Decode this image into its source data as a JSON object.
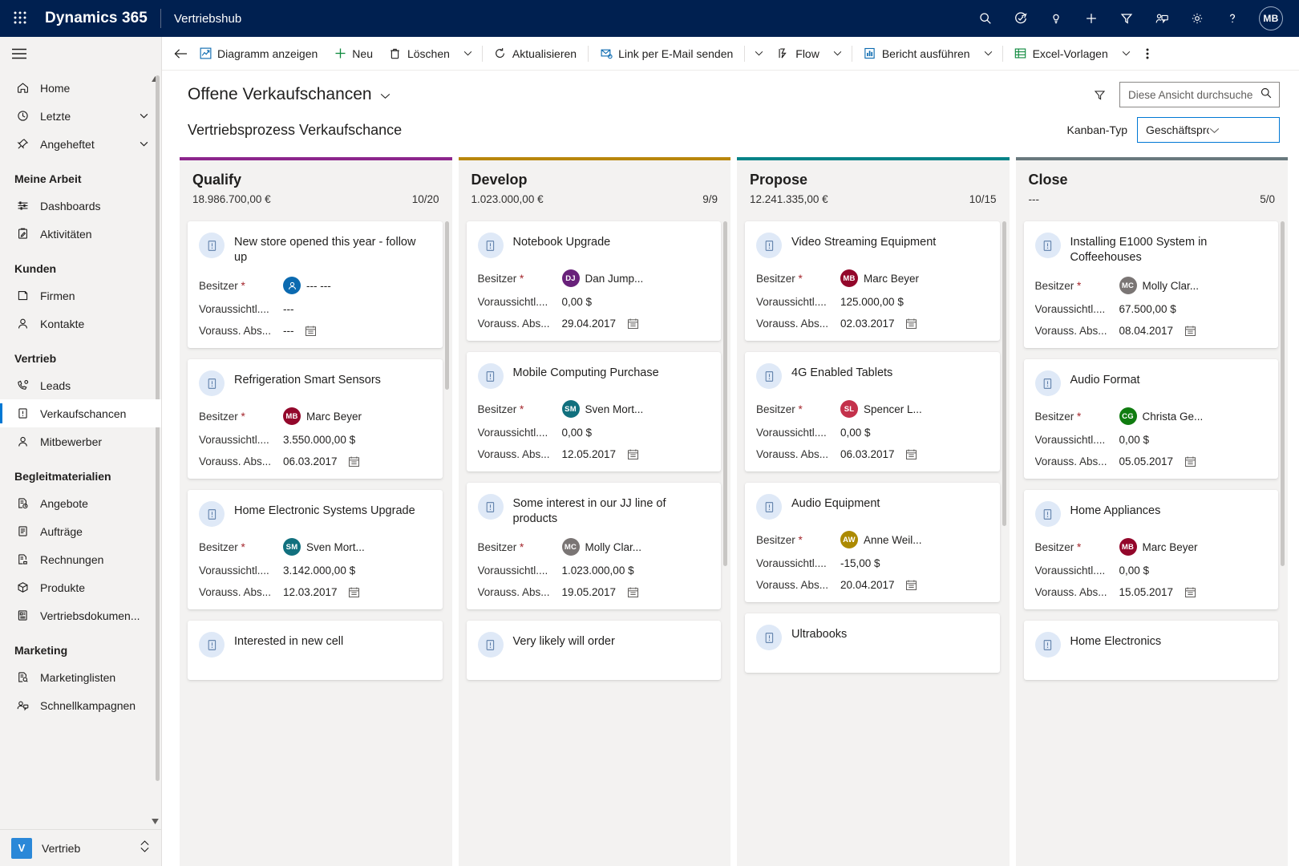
{
  "topnav": {
    "waffle_icon": "app-launcher-icon",
    "brand": "Dynamics 365",
    "app_name": "Vertriebshub",
    "icons": [
      {
        "name": "search-icon"
      },
      {
        "name": "relationship-assistant-icon"
      },
      {
        "name": "lightbulb-icon"
      },
      {
        "name": "quick-create-icon"
      },
      {
        "name": "filter-icon"
      },
      {
        "name": "assistant-card-icon"
      },
      {
        "name": "settings-gear-icon"
      },
      {
        "name": "help-question-icon"
      }
    ],
    "avatar": "MB"
  },
  "commandbar": {
    "back_icon": "back-arrow-icon",
    "items": [
      {
        "label": "Diagramm anzeigen",
        "icon": "chart-icon",
        "chevron": false
      },
      {
        "label": "Neu",
        "icon": "plus-icon",
        "chevron": false
      },
      {
        "label": "Löschen",
        "icon": "trash-icon",
        "chevron": true
      },
      {
        "label": "Aktualisieren",
        "icon": "refresh-icon",
        "chevron": false
      },
      {
        "label": "Link per E-Mail senden",
        "icon": "email-link-icon",
        "chevron": true
      },
      {
        "label": "Flow",
        "icon": "flow-icon",
        "chevron": true
      },
      {
        "label": "Bericht ausführen",
        "icon": "report-icon",
        "chevron": true
      },
      {
        "label": "Excel-Vorlagen",
        "icon": "excel-icon",
        "chevron": true
      }
    ],
    "overflow_icon": "more-vertical-icon"
  },
  "viewbar": {
    "view_title": "Offene Verkaufschancen",
    "view_chevron_icon": "chevron-down-icon",
    "filter_icon": "filter-icon",
    "search_placeholder": "Diese Ansicht durchsuche",
    "search_value": "",
    "search_icon": "search-icon"
  },
  "process": {
    "title": "Vertriebsprozess Verkaufschance",
    "kanban_label": "Kanban-Typ",
    "kanban_value": "Geschäftsprozessfluss",
    "kanban_chevron_icon": "chevron-down-icon"
  },
  "sidebar": {
    "hamburger_icon": "hamburger-icon",
    "top_items": [
      {
        "label": "Home",
        "icon": "home-icon",
        "chevron": false,
        "active": false
      },
      {
        "label": "Letzte",
        "icon": "clock-icon",
        "chevron": true,
        "active": false
      },
      {
        "label": "Angeheftet",
        "icon": "pin-icon",
        "chevron": true,
        "active": false
      }
    ],
    "groups": [
      {
        "title": "Meine Arbeit",
        "items": [
          {
            "label": "Dashboards",
            "icon": "dashboard-icon",
            "active": false
          },
          {
            "label": "Aktivitäten",
            "icon": "activities-icon",
            "active": false
          }
        ]
      },
      {
        "title": "Kunden",
        "items": [
          {
            "label": "Firmen",
            "icon": "accounts-icon",
            "active": false
          },
          {
            "label": "Kontakte",
            "icon": "contacts-icon",
            "active": false
          }
        ]
      },
      {
        "title": "Vertrieb",
        "items": [
          {
            "label": "Leads",
            "icon": "leads-icon",
            "active": false
          },
          {
            "label": "Verkaufschancen",
            "icon": "opportunities-icon",
            "active": true
          },
          {
            "label": "Mitbewerber",
            "icon": "competitors-icon",
            "active": false
          }
        ]
      },
      {
        "title": "Begleitmaterialien",
        "items": [
          {
            "label": "Angebote",
            "icon": "quotes-icon",
            "active": false
          },
          {
            "label": "Aufträge",
            "icon": "orders-icon",
            "active": false
          },
          {
            "label": "Rechnungen",
            "icon": "invoices-icon",
            "active": false
          },
          {
            "label": "Produkte",
            "icon": "products-icon",
            "active": false
          },
          {
            "label": "Vertriebsdokumen...",
            "icon": "sales-literature-icon",
            "active": false
          }
        ]
      },
      {
        "title": "Marketing",
        "items": [
          {
            "label": "Marketinglisten",
            "icon": "marketing-lists-icon",
            "active": false
          },
          {
            "label": "Schnellkampagnen",
            "icon": "quick-campaigns-icon",
            "active": false
          }
        ]
      }
    ],
    "app_switcher": {
      "initial": "V",
      "label": "Vertrieb",
      "chevron_icon": "updown-chevron-icon"
    }
  },
  "card_labels": {
    "owner": "Besitzer",
    "required_mark": "*",
    "est_revenue": "Voraussichtl....",
    "est_close": "Vorauss. Abs...",
    "calendar_icon": "calendar-icon",
    "record-icon": "opportunity-record-icon"
  },
  "board": {
    "columns": [
      {
        "name": "Qualify",
        "accent": "#8c258c",
        "sum": "18.986.700,00 €",
        "count": "10/20",
        "cards": [
          {
            "title": "New store opened this year - follow up",
            "owner": "--- ---",
            "owner_initials": "",
            "owner_color": "#0b6ab0",
            "revenue": "---",
            "close_date": "---"
          },
          {
            "title": "Refrigeration Smart Sensors",
            "owner": "Marc Beyer",
            "owner_initials": "MB",
            "owner_color": "#93072b",
            "revenue": "3.550.000,00 $",
            "close_date": "06.03.2017"
          },
          {
            "title": "Home Electronic Systems Upgrade",
            "owner": "Sven Mort...",
            "owner_initials": "SM",
            "owner_color": "#11707e",
            "revenue": "3.142.000,00 $",
            "close_date": "12.03.2017"
          },
          {
            "title": "Interested in new cell",
            "owner": "",
            "owner_initials": "",
            "owner_color": "#0b6ab0",
            "revenue": "",
            "close_date": ""
          }
        ]
      },
      {
        "name": "Develop",
        "accent": "#b8860b",
        "sum": "1.023.000,00 €",
        "count": "9/9",
        "cards": [
          {
            "title": "Notebook Upgrade",
            "owner": "Dan Jump...",
            "owner_initials": "DJ",
            "owner_color": "#68217a",
            "revenue": "0,00 $",
            "close_date": "29.04.2017"
          },
          {
            "title": "Mobile Computing Purchase",
            "owner": "Sven Mort...",
            "owner_initials": "SM",
            "owner_color": "#11707e",
            "revenue": "0,00 $",
            "close_date": "12.05.2017"
          },
          {
            "title": "Some interest in our JJ line of products",
            "owner": "Molly Clar...",
            "owner_initials": "MC",
            "owner_color": "#7a7574",
            "revenue": "1.023.000,00 $",
            "close_date": "19.05.2017"
          },
          {
            "title": "Very likely will order",
            "owner": "",
            "owner_initials": "",
            "owner_color": "#0b6ab0",
            "revenue": "",
            "close_date": ""
          }
        ]
      },
      {
        "name": "Propose",
        "accent": "#038387",
        "sum": "12.241.335,00 €",
        "count": "10/15",
        "cards": [
          {
            "title": "Video Streaming Equipment",
            "owner": "Marc Beyer",
            "owner_initials": "MB",
            "owner_color": "#93072b",
            "revenue": "125.000,00 $",
            "close_date": "02.03.2017"
          },
          {
            "title": "4G Enabled Tablets",
            "owner": "Spencer L...",
            "owner_initials": "SL",
            "owner_color": "#c4314b",
            "revenue": "0,00 $",
            "close_date": "06.03.2017"
          },
          {
            "title": "Audio Equipment",
            "owner": "Anne Weil...",
            "owner_initials": "AW",
            "owner_color": "#ac8a00",
            "revenue": "-15,00 $",
            "close_date": "20.04.2017"
          },
          {
            "title": "Ultrabooks",
            "owner": "",
            "owner_initials": "",
            "owner_color": "#0b6ab0",
            "revenue": "",
            "close_date": ""
          }
        ]
      },
      {
        "name": "Close",
        "accent": "#69797e",
        "sum": "---",
        "count": "5/0",
        "cards": [
          {
            "title": "Installing E1000 System in Coffeehouses",
            "owner": "Molly Clar...",
            "owner_initials": "MC",
            "owner_color": "#7a7574",
            "revenue": "67.500,00 $",
            "close_date": "08.04.2017"
          },
          {
            "title": "Audio Format",
            "owner": "Christa Ge...",
            "owner_initials": "CG",
            "owner_color": "#107c10",
            "revenue": "0,00 $",
            "close_date": "05.05.2017"
          },
          {
            "title": "Home Appliances",
            "owner": "Marc Beyer",
            "owner_initials": "MB",
            "owner_color": "#93072b",
            "revenue": "0,00 $",
            "close_date": "15.05.2017"
          },
          {
            "title": "Home Electronics",
            "owner": "",
            "owner_initials": "",
            "owner_color": "#0b6ab0",
            "revenue": "",
            "close_date": ""
          }
        ]
      }
    ]
  }
}
